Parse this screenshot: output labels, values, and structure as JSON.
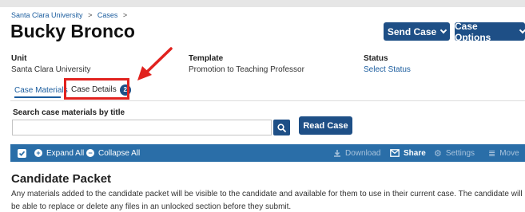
{
  "breadcrumb": {
    "items": [
      "Santa Clara University",
      "Cases"
    ],
    "separator": ">"
  },
  "page": {
    "title": "Bucky Bronco"
  },
  "header_buttons": {
    "send_case": "Send Case",
    "case_options": "Case Options"
  },
  "fields": {
    "unit": {
      "label": "Unit",
      "value": "Santa Clara University"
    },
    "template": {
      "label": "Template",
      "value": "Promotion to Teaching Professor"
    },
    "status": {
      "label": "Status",
      "value": "Select Status"
    }
  },
  "tabs": [
    {
      "label": "Case Materials",
      "active": true
    },
    {
      "label": "Case Details",
      "badge": "2"
    }
  ],
  "search": {
    "label": "Search case materials by title",
    "value": "",
    "placeholder": ""
  },
  "read_case": "Read Case",
  "toolbar": {
    "expand_all": "Expand All",
    "collapse_all": "Collapse All",
    "download": "Download",
    "share": "Share",
    "settings": "Settings",
    "move": "Move"
  },
  "section": {
    "title": "Candidate Packet",
    "description": "Any materials added to the candidate packet will be visible to the candidate and available for them to use in their current case. The candidate will be able to replace or delete any files in an unlocked section before they submit."
  },
  "colors": {
    "primary": "#1e4f86",
    "toolbar": "#2a6ea8",
    "highlight": "#e1221e",
    "link": "#1a5c9e"
  },
  "icons": [
    "search-icon",
    "chevron-down-icon",
    "check-icon",
    "plus-circle-icon",
    "minus-circle-icon",
    "download-icon",
    "mail-icon",
    "gear-icon",
    "move-icon",
    "annotation-arrow-icon"
  ]
}
